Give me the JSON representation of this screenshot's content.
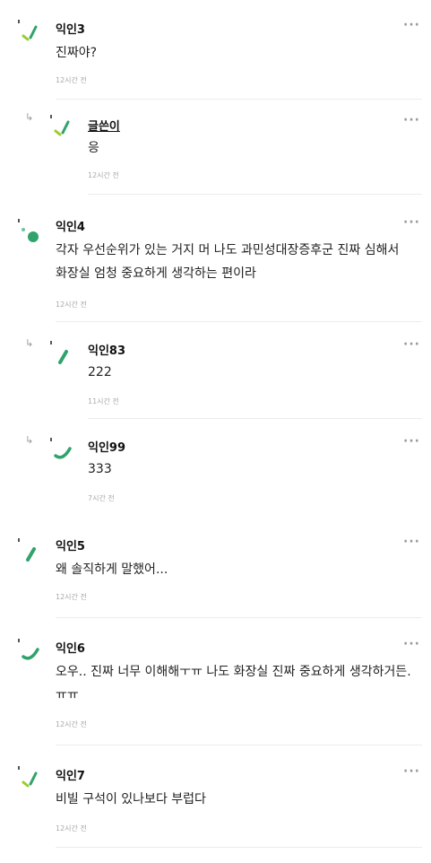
{
  "more_label": "···",
  "reply_arrow": "↳",
  "comments": [
    {
      "author": "익인3",
      "text": "진짜야?",
      "time": "12시간 전",
      "avatar": "green-yellow-sparkle"
    },
    {
      "author": "글쓴이",
      "text": "응",
      "time": "12시간 전",
      "avatar": "green-yellow-sparkle"
    },
    {
      "author": "익인4",
      "text": "각자 우선순위가 있는 거지 머 나도 과민성대장증후군 진짜 심해서 화장실 엄청 중요하게 생각하는 편이라",
      "time": "12시간 전",
      "avatar": "green-dot"
    },
    {
      "author": "익인83",
      "text": "222",
      "time": "11시간 전",
      "avatar": "green-slash"
    },
    {
      "author": "익인99",
      "text": "333",
      "time": "7시간 전",
      "avatar": "green-curve"
    },
    {
      "author": "익인5",
      "text": "왜 솔직하게 말했어...",
      "time": "12시간 전",
      "avatar": "green-slash"
    },
    {
      "author": "익인6",
      "text": "오우.. 진짜 너무 이해해ㅜㅠ 나도 화장실 진짜 중요하게 생각하거든.ㅠㅠ",
      "time": "12시간 전",
      "avatar": "green-curve"
    },
    {
      "author": "익인7",
      "text": "비빌 구석이 있나보다 부럽다",
      "time": "12시간 전",
      "avatar": "green-yellow-sparkle"
    }
  ]
}
